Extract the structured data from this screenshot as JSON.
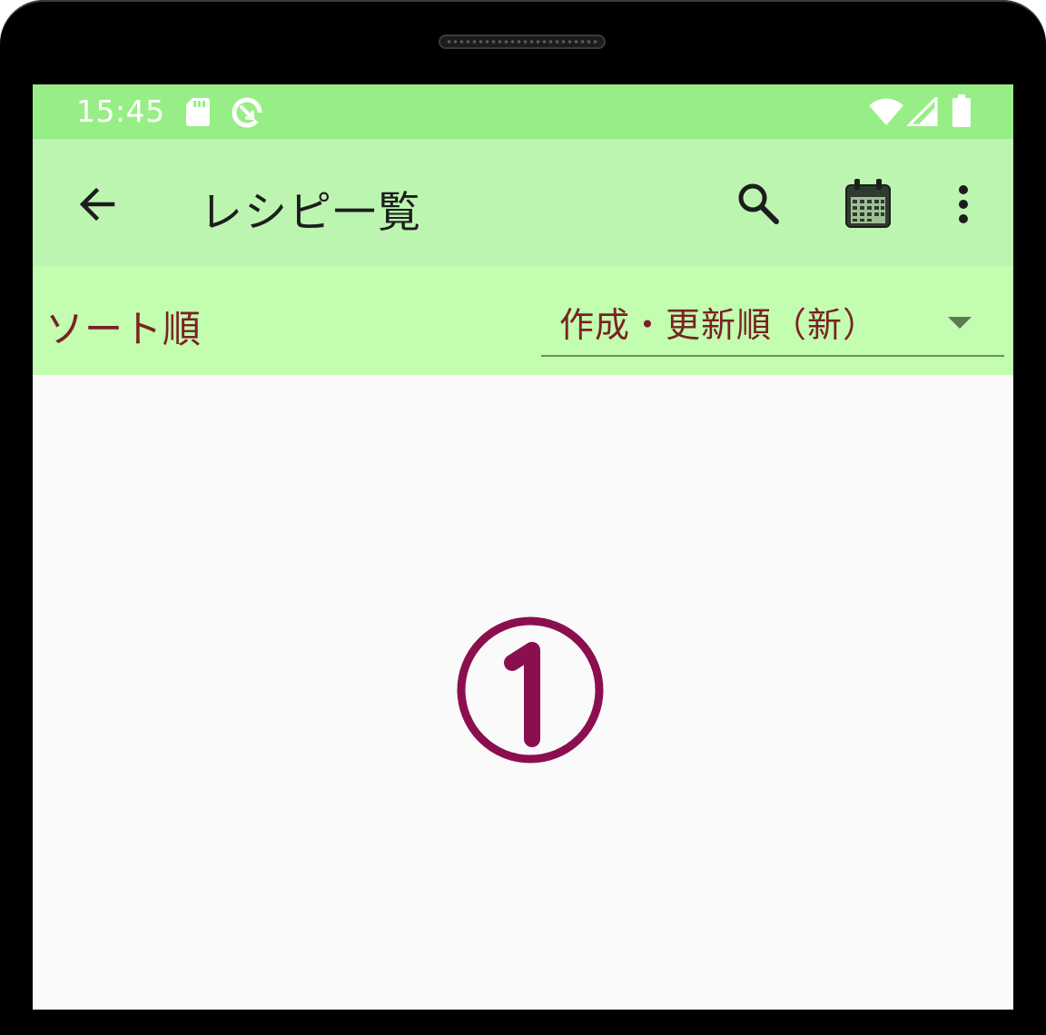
{
  "status_bar": {
    "time": "15:45",
    "icons": [
      "sd-card-icon",
      "data-saver-icon",
      "wifi-icon",
      "cell-signal-icon",
      "battery-icon"
    ]
  },
  "app_bar": {
    "title": "レシピ一覧",
    "icons": [
      "back-arrow-icon",
      "search-icon",
      "calendar-icon",
      "more-vert-icon"
    ]
  },
  "sort_bar": {
    "label": "ソート順",
    "selected": "作成・更新順（新）"
  },
  "overlay": {
    "marker": "①"
  },
  "colors": {
    "status_bar": "#98ee86",
    "app_bar": "#bcf5b0",
    "sort_bar": "#c2fdb0",
    "sort_text": "#7a2222",
    "marker": "#8b0f4f",
    "content_bg": "#fafafa"
  }
}
